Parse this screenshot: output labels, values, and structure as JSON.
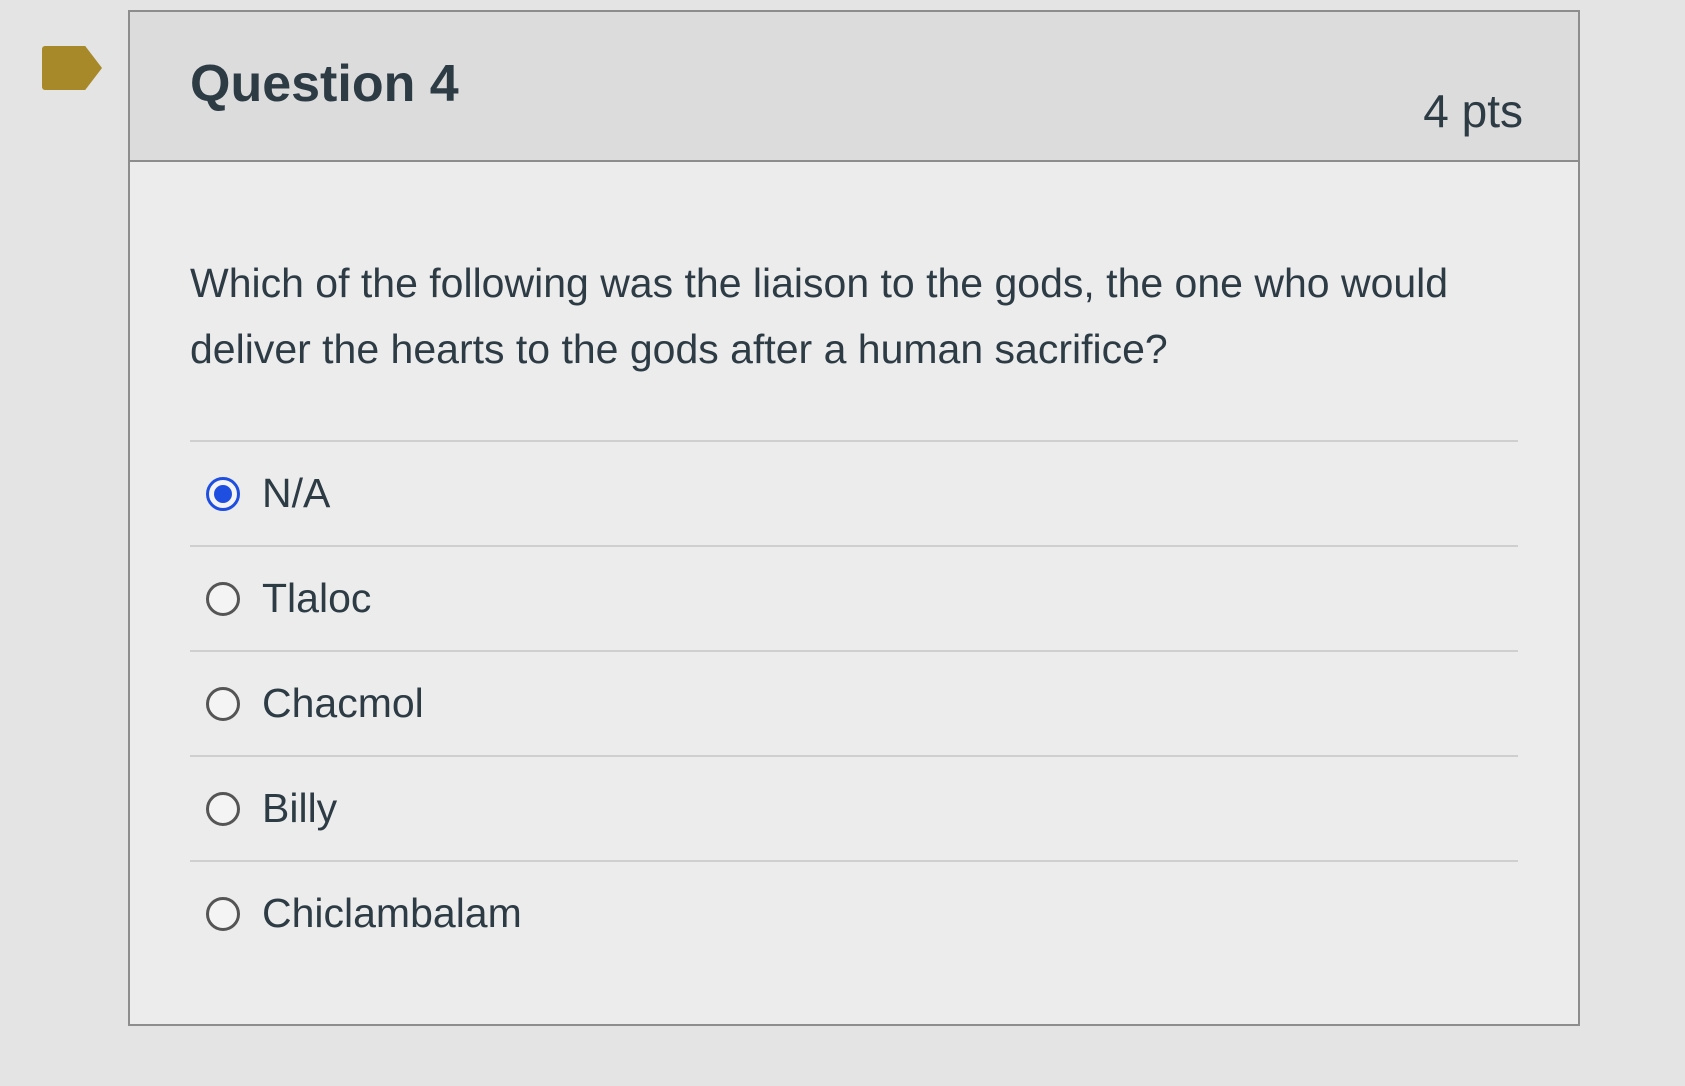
{
  "question": {
    "title": "Question 4",
    "points": "4 pts",
    "text": "Which of the following was the liaison to the gods, the one who would deliver the hearts to the gods after a human sacrifice?",
    "selected_index": 0,
    "answers": [
      {
        "label": "N/A",
        "selected": true
      },
      {
        "label": "Tlaloc",
        "selected": false
      },
      {
        "label": "Chacmol",
        "selected": false
      },
      {
        "label": "Billy",
        "selected": false
      },
      {
        "label": "Chiclambalam",
        "selected": false
      }
    ]
  },
  "colors": {
    "accent": "#1f4fe0",
    "flag": "#a8892a",
    "text": "#2d3b45"
  },
  "icons": {
    "flag": "bookmark-flag-icon",
    "radio_selected": "radio-checked-icon",
    "radio_unselected": "radio-unchecked-icon"
  }
}
